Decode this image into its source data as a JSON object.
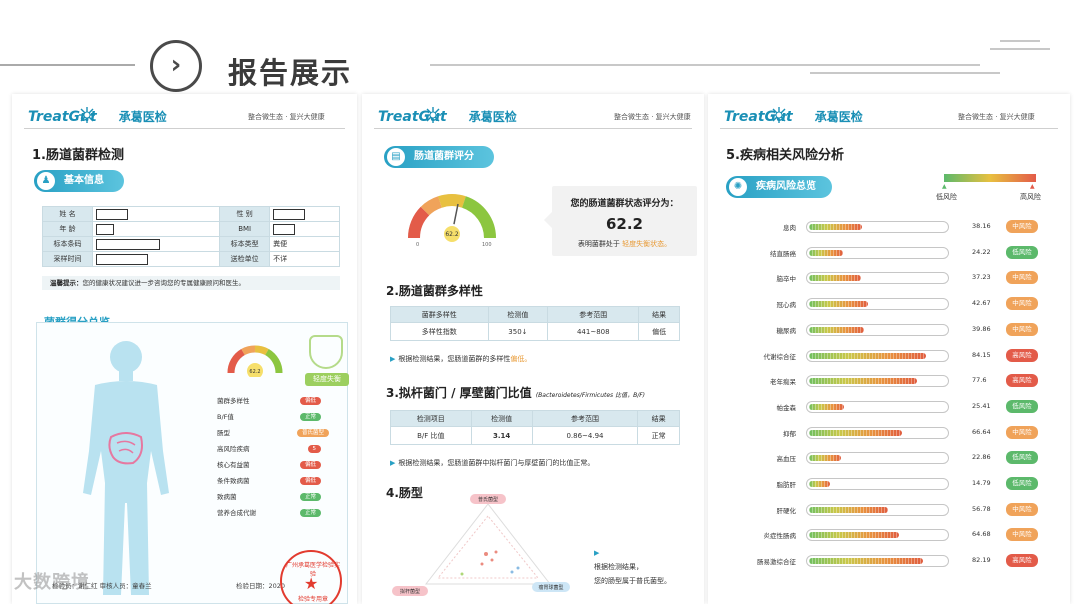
{
  "header": {
    "title": "报告展示",
    "nav_glyph": "›"
  },
  "brand": {
    "logo_en": "TreatGut",
    "logo_cn": "承葛医检",
    "slogan": "整合微生态 · 复兴大健康"
  },
  "page1": {
    "heading": "1.肠道菌群检测",
    "basic_pill": "基本信息",
    "info_rows": [
      {
        "k1": "姓  名",
        "v1": "",
        "k2": "性  别",
        "v2": ""
      },
      {
        "k1": "年  龄",
        "v1": "",
        "k2": "BMI",
        "v2": ""
      },
      {
        "k1": "标本条码",
        "v1": "",
        "k2": "标本类型",
        "v2": "粪便"
      },
      {
        "k1": "采样时间",
        "v1": "",
        "k2": "送检单位",
        "v2": "不详"
      }
    ],
    "tip_label": "温馨提示：",
    "tip_text": "您的健康状况建议进一步咨询您的专属健康顾问和医生。",
    "score_pill": "菌群得分总览",
    "gauge_value": "62.2",
    "mild_tag": "轻度失衡",
    "badges": [
      {
        "label": "菌群多样性",
        "status": "偏低",
        "color": "red"
      },
      {
        "label": "B/F值",
        "status": "正常",
        "color": "green"
      },
      {
        "label": "肠型",
        "status": "普氏菌型",
        "color": "orange"
      },
      {
        "label": "高风险疾病",
        "status": "5",
        "color": "red"
      },
      {
        "label": "核心有益菌",
        "status": "偏低",
        "color": "red"
      },
      {
        "label": "条件致病菌",
        "status": "偏低",
        "color": "red"
      },
      {
        "label": "致病菌",
        "status": "正常",
        "color": "green"
      },
      {
        "label": "营养合成代谢",
        "status": "正常",
        "color": "green"
      }
    ],
    "footer_left": "检验员：谢仁红    审核人员：童春兰",
    "footer_right": "检验日期：2020",
    "stamp_top": "广州承葛医学检验实验",
    "stamp_bottom": "检验专用章"
  },
  "page2": {
    "score_pill": "肠道菌群评分",
    "gauge_value": "62.2",
    "callout_line1": "您的肠道菌群状态评分为：",
    "callout_score": "62.2",
    "callout_line3_pre": "表明菌群处于",
    "callout_line3_status": "轻度失衡状态。",
    "div_heading": "2.肠道菌群多样性",
    "div_table": {
      "headers": [
        "菌群多样性",
        "检测值",
        "参考范围",
        "结果"
      ],
      "row": [
        "多样性指数",
        "350↓",
        "441~808",
        "偏低"
      ]
    },
    "div_note_pre": "根据检测结果，您肠道菌群的多样性",
    "div_note_status": "偏低。",
    "bf_heading": "3.拟杆菌门 / 厚壁菌门比值",
    "bf_heading_latin": "(Bacteroidetes/Firmicutes 比值，B/F)",
    "bf_table": {
      "headers": [
        "检测项目",
        "检测值",
        "参考范围",
        "结果"
      ],
      "row": [
        "B/F 比值",
        "3.14",
        "0.86~4.94",
        "正常"
      ]
    },
    "bf_note": "根据检测结果，您肠道菌群中拟杆菌门与厚壁菌门的比值正常。",
    "type_heading": "4.肠型",
    "type_labels": {
      "top": "普氏菌型",
      "left": "拟杆菌型",
      "right": "瘤胃球菌型"
    },
    "type_note1": "根据检测结果，",
    "type_note2": "您的肠型属于普氏菌型。"
  },
  "page3": {
    "heading": "5.疾病相关风险分析",
    "pill": "疾病风险总览",
    "legend_low": "低风险",
    "legend_high": "高风险",
    "risks": [
      {
        "name": "息肉",
        "value": "38.16",
        "tag": "中风险",
        "level": "mid"
      },
      {
        "name": "结直肠癌",
        "value": "24.22",
        "tag": "低风险",
        "level": "low"
      },
      {
        "name": "脑卒中",
        "value": "37.23",
        "tag": "中风险",
        "level": "mid"
      },
      {
        "name": "冠心病",
        "value": "42.67",
        "tag": "中风险",
        "level": "mid"
      },
      {
        "name": "糖尿病",
        "value": "39.86",
        "tag": "中风险",
        "level": "mid"
      },
      {
        "name": "代谢综合征",
        "value": "84.15",
        "tag": "高风险",
        "level": "high"
      },
      {
        "name": "老年痴呆",
        "value": "77.6",
        "tag": "高风险",
        "level": "high"
      },
      {
        "name": "帕金森",
        "value": "25.41",
        "tag": "低风险",
        "level": "low"
      },
      {
        "name": "抑郁",
        "value": "66.64",
        "tag": "中风险",
        "level": "mid"
      },
      {
        "name": "高血压",
        "value": "22.86",
        "tag": "低风险",
        "level": "low"
      },
      {
        "name": "脂肪肝",
        "value": "14.79",
        "tag": "低风险",
        "level": "low"
      },
      {
        "name": "肝硬化",
        "value": "56.78",
        "tag": "中风险",
        "level": "mid"
      },
      {
        "name": "炎症性肠病",
        "value": "64.68",
        "tag": "中风险",
        "level": "mid"
      },
      {
        "name": "肠易激综合征",
        "value": "82.19",
        "tag": "高风险",
        "level": "high"
      }
    ]
  },
  "watermark": "大数跨境",
  "colors": {
    "accent": "#28a0c4",
    "low": "#5cb96b",
    "mid": "#f0a35a",
    "high": "#e35b49"
  }
}
